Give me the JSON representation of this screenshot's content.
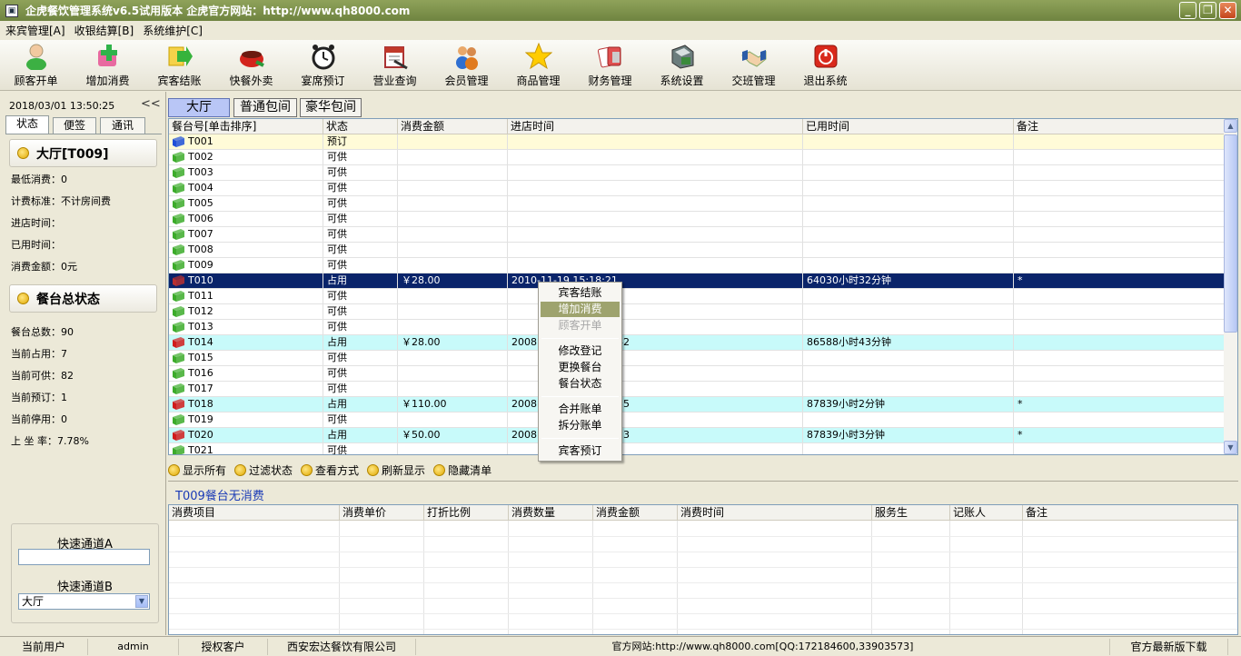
{
  "window": {
    "title": "企虎餐饮管理系统v6.5试用版本  企虎官方网站：http://www.qh8000.com",
    "minimize": "_",
    "restore": "❐",
    "close": "✕"
  },
  "menu": [
    "来宾管理[A]",
    "收银结算[B]",
    "系统维护[C]"
  ],
  "toolbar": [
    {
      "label": "顾客开单",
      "icon": "person-icon"
    },
    {
      "label": "增加消费",
      "icon": "add-cross-icon"
    },
    {
      "label": "宾客结账",
      "icon": "arrow-right-icon"
    },
    {
      "label": "快餐外卖",
      "icon": "takeout-bowl-icon"
    },
    {
      "label": "宴席预订",
      "icon": "alarm-clock-icon"
    },
    {
      "label": "营业查询",
      "icon": "calendar-search-icon"
    },
    {
      "label": "会员管理",
      "icon": "members-icon"
    },
    {
      "label": "商品管理",
      "icon": "star-icon"
    },
    {
      "label": "财务管理",
      "icon": "cards-icon"
    },
    {
      "label": "系统设置",
      "icon": "settings-box-icon"
    },
    {
      "label": "交班管理",
      "icon": "handshake-icon"
    },
    {
      "label": "退出系统",
      "icon": "power-icon"
    }
  ],
  "left": {
    "clock": "2018/03/01  13:50:25",
    "collapse": "<<",
    "tabs": [
      "状态",
      "便签",
      "通讯"
    ],
    "table_section_title": "大厅[T009]",
    "table_info": [
      {
        "label": "最低消费：",
        "value": "0"
      },
      {
        "label": "计费标准：",
        "value": "不计房间费"
      },
      {
        "label": "进店时间：",
        "value": ""
      },
      {
        "label": "已用时间：",
        "value": ""
      },
      {
        "label": "消费金额：",
        "value": "0元"
      }
    ],
    "summary_section_title": "餐台总状态",
    "summary": [
      {
        "label": "餐台总数：",
        "value": "90"
      },
      {
        "label": "当前占用：",
        "value": "7"
      },
      {
        "label": "当前可供：",
        "value": "82"
      },
      {
        "label": "当前预订：",
        "value": "1"
      },
      {
        "label": "当前停用：",
        "value": "0"
      },
      {
        "label": "上 坐 率：",
        "value": "7.78%"
      }
    ],
    "quick_a_label": "快速通道A",
    "quick_a_value": "",
    "quick_b_label": "快速通道B",
    "quick_b_value": "大厅"
  },
  "main_tabs": [
    "大厅",
    "普通包间",
    "豪华包间"
  ],
  "table": {
    "headers": [
      "餐台号[单击排序]",
      "状态",
      "消费金额",
      "进店时间",
      "已用时间",
      "备注"
    ],
    "rows": [
      {
        "id": "T001",
        "status": "预订",
        "amount": "",
        "time_in": "",
        "elapsed": "",
        "note": "",
        "kind": "reserved",
        "flag": "#1f4fd8"
      },
      {
        "id": "T002",
        "status": "可供",
        "amount": "",
        "time_in": "",
        "elapsed": "",
        "note": "",
        "kind": "free",
        "flag": "#3cab2a"
      },
      {
        "id": "T003",
        "status": "可供",
        "amount": "",
        "time_in": "",
        "elapsed": "",
        "note": "",
        "kind": "free",
        "flag": "#3cab2a"
      },
      {
        "id": "T004",
        "status": "可供",
        "amount": "",
        "time_in": "",
        "elapsed": "",
        "note": "",
        "kind": "free",
        "flag": "#3cab2a"
      },
      {
        "id": "T005",
        "status": "可供",
        "amount": "",
        "time_in": "",
        "elapsed": "",
        "note": "",
        "kind": "free",
        "flag": "#3cab2a"
      },
      {
        "id": "T006",
        "status": "可供",
        "amount": "",
        "time_in": "",
        "elapsed": "",
        "note": "",
        "kind": "free",
        "flag": "#3cab2a"
      },
      {
        "id": "T007",
        "status": "可供",
        "amount": "",
        "time_in": "",
        "elapsed": "",
        "note": "",
        "kind": "free",
        "flag": "#3cab2a"
      },
      {
        "id": "T008",
        "status": "可供",
        "amount": "",
        "time_in": "",
        "elapsed": "",
        "note": "",
        "kind": "free",
        "flag": "#3cab2a"
      },
      {
        "id": "T009",
        "status": "可供",
        "amount": "",
        "time_in": "",
        "elapsed": "",
        "note": "",
        "kind": "free",
        "flag": "#3cab2a"
      },
      {
        "id": "T010",
        "status": "占用",
        "amount": "￥28.00",
        "time_in": "2010-11-19 15:18:21",
        "elapsed": "64030小时32分钟",
        "note": "*",
        "kind": "selected",
        "flag": "#b83030"
      },
      {
        "id": "T011",
        "status": "可供",
        "amount": "",
        "time_in": "",
        "elapsed": "",
        "note": "",
        "kind": "free",
        "flag": "#3cab2a"
      },
      {
        "id": "T012",
        "status": "可供",
        "amount": "",
        "time_in": "",
        "elapsed": "",
        "note": "",
        "kind": "free",
        "flag": "#3cab2a"
      },
      {
        "id": "T013",
        "status": "可供",
        "amount": "",
        "time_in": "",
        "elapsed": "",
        "note": "",
        "kind": "free",
        "flag": "#3cab2a"
      },
      {
        "id": "T014",
        "status": "占用",
        "amount": "￥28.00",
        "time_in": "2008",
        "time_in_tail": "42",
        "elapsed": "86588小时43分钟",
        "note": "",
        "kind": "occupied",
        "flag": "#d01c1c"
      },
      {
        "id": "T015",
        "status": "可供",
        "amount": "",
        "time_in": "",
        "elapsed": "",
        "note": "",
        "kind": "free",
        "flag": "#3cab2a"
      },
      {
        "id": "T016",
        "status": "可供",
        "amount": "",
        "time_in": "",
        "elapsed": "",
        "note": "",
        "kind": "free",
        "flag": "#3cab2a"
      },
      {
        "id": "T017",
        "status": "可供",
        "amount": "",
        "time_in": "",
        "elapsed": "",
        "note": "",
        "kind": "free",
        "flag": "#3cab2a"
      },
      {
        "id": "T018",
        "status": "占用",
        "amount": "￥110.00",
        "time_in": "2008",
        "time_in_tail": "35",
        "elapsed": "87839小时2分钟",
        "note": "*",
        "kind": "occupied",
        "flag": "#d01c1c"
      },
      {
        "id": "T019",
        "status": "可供",
        "amount": "",
        "time_in": "",
        "elapsed": "",
        "note": "",
        "kind": "free",
        "flag": "#3cab2a"
      },
      {
        "id": "T020",
        "status": "占用",
        "amount": "￥50.00",
        "time_in": "2008",
        "time_in_tail": "53",
        "elapsed": "87839小时3分钟",
        "note": "*",
        "kind": "occupied",
        "flag": "#d01c1c"
      },
      {
        "id": "T021",
        "status": "可供",
        "amount": "",
        "time_in": "",
        "elapsed": "",
        "note": "",
        "kind": "free",
        "flag": "#3cab2a"
      }
    ]
  },
  "actions": [
    "显示所有",
    "过滤状态",
    "查看方式",
    "刷新显示",
    "隐藏清单"
  ],
  "detail_title": "T009餐台无消费",
  "detail_headers": [
    "消费项目",
    "消费单价",
    "打折比例",
    "消费数量",
    "消费金额",
    "消费时间",
    "服务生",
    "记账人",
    "备注"
  ],
  "context_menu": {
    "items": [
      "宾客结账",
      "增加消费",
      "顾客开单",
      "修改登记",
      "更换餐台",
      "餐台状态",
      "合并账单",
      "拆分账单",
      "宾客预订"
    ],
    "highlighted": "增加消费",
    "disabled": "顾客开单"
  },
  "statusbar": {
    "user_label": "当前用户",
    "user": "admin",
    "client_label": "授权客户",
    "client": "西安宏达餐饮有限公司",
    "website": "官方网站:http://www.qh8000.com[QQ:172184600,33903573]",
    "download": "官方最新版下载"
  }
}
